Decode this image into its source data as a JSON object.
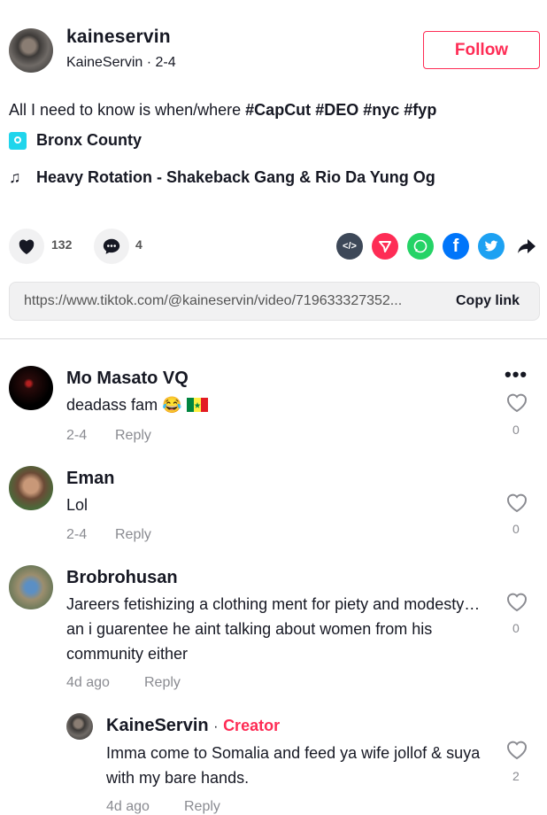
{
  "post": {
    "username": "kaineservin",
    "display_name": "KaineServin",
    "date": "2-4",
    "follow_label": "Follow",
    "caption_text": "All I need to know is when/where",
    "hashtags": [
      "#CapCut",
      "#DEO",
      "#nyc",
      "#fyp"
    ],
    "location": "Bronx County",
    "music": "Heavy Rotation - Shakeback Gang & Rio Da Yung Og",
    "likes": "132",
    "comments": "4",
    "link_url": "https://www.tiktok.com/@kaineservin/video/719633327352...",
    "copy_link_label": "Copy link"
  },
  "share_icons": [
    "embed-icon",
    "send-icon",
    "whatsapp-icon",
    "facebook-icon",
    "twitter-icon",
    "share-arrow-icon"
  ],
  "colors": {
    "accent": "#fe2c55",
    "location": "#20d5ec",
    "whatsapp": "#25d366",
    "facebook": "#0075fa",
    "twitter": "#1da1f2",
    "embed": "#3d4858"
  },
  "comments": [
    {
      "name": "Mo Masato VQ",
      "text": "deadass fam 😂",
      "date": "2-4",
      "reply": "Reply",
      "likes": "0"
    },
    {
      "name": "Eman",
      "text": "Lol",
      "date": "2-4",
      "reply": "Reply",
      "likes": "0"
    },
    {
      "name": "Brobrohusan",
      "text": "Jareers fetishizing a clothing ment for piety and modesty…an i guarentee he aint talking about women from his community either",
      "date": "4d ago",
      "reply": "Reply",
      "likes": "0"
    }
  ],
  "reply": {
    "name": "KaineServin",
    "badge": "Creator",
    "separator": "·",
    "text": "Imma come to Somalia and feed ya wife jollof & suya with my bare hands.",
    "date": "4d ago",
    "reply": "Reply",
    "likes": "2"
  }
}
